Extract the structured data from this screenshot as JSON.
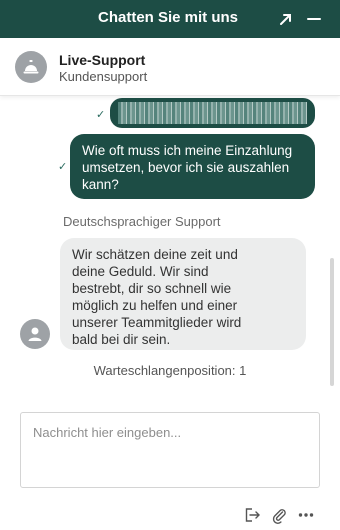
{
  "header": {
    "title": "Chatten Sie mit uns",
    "expand_icon": "arrow-up-right-icon",
    "minimize_icon": "minus-icon",
    "background": "#1d4d45"
  },
  "agent": {
    "name": "Live-Support",
    "subtitle": "Kundensupport",
    "avatar_icon": "service-bell-icon"
  },
  "messages": {
    "outgoing_check": "✓",
    "outgoing_blurred": "",
    "outgoing_question": "Wie oft muss ich meine Einzahlung\numsetzen, bevor ich sie auszahlen\nkann?",
    "system_label": "Deutschsprachiger Support",
    "incoming_text": "Wir schätzen deine zeit und\ndeine Geduld. Wir sind\nbestrebt, dir so schnell wie\nmöglich zu helfen und einer\nunserer Teammitglieder wird\nbald bei dir sein.",
    "queue_position": "Warteschlangenposition: 1"
  },
  "composer": {
    "placeholder": "Nachricht hier eingeben...",
    "value": ""
  },
  "footer": {
    "exit_icon": "exit-chat-icon",
    "attach_icon": "paperclip-icon",
    "more_icon": "more-dots-icon"
  },
  "colors": {
    "accent": "#1d4d45",
    "incoming_bubble": "#eceded"
  }
}
